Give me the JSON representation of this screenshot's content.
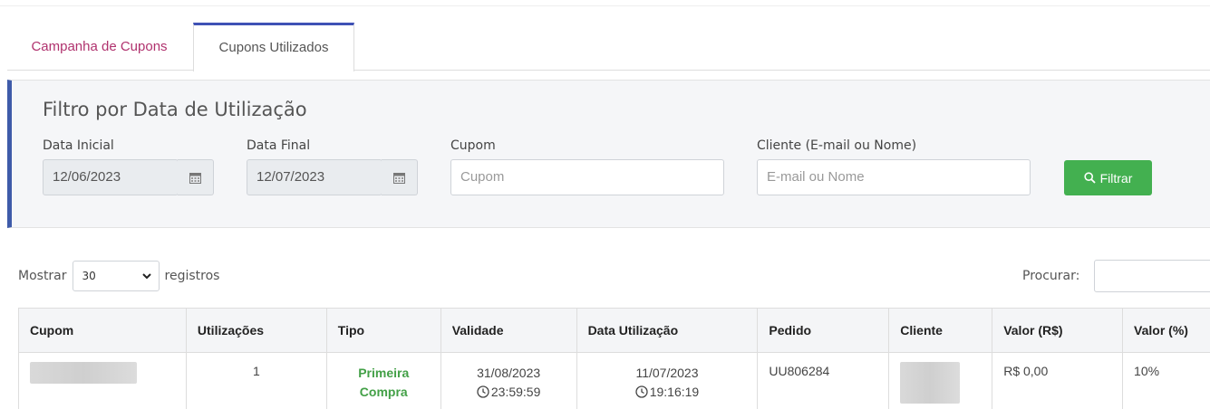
{
  "tabs": [
    {
      "label": "Campanha de Cupons",
      "active": false
    },
    {
      "label": "Cupons Utilizados",
      "active": true
    }
  ],
  "filter": {
    "title": "Filtro por Data de Utilização",
    "data_inicial": {
      "label": "Data Inicial",
      "value": "12/06/2023"
    },
    "data_final": {
      "label": "Data Final",
      "value": "12/07/2023"
    },
    "cupom": {
      "label": "Cupom",
      "placeholder": "Cupom"
    },
    "cliente": {
      "label": "Cliente (E-mail ou Nome)",
      "placeholder": "E-mail ou Nome"
    },
    "button_label": "Filtrar"
  },
  "length": {
    "prefix": "Mostrar",
    "value": "30",
    "suffix": "registros"
  },
  "search": {
    "label": "Procurar:"
  },
  "table": {
    "columns": [
      "Cupom",
      "Utilizações",
      "Tipo",
      "Validade",
      "Data Utilização",
      "Pedido",
      "Cliente",
      "Valor (R$)",
      "Valor (%)"
    ],
    "rows": [
      {
        "utilizacoes": "1",
        "tipo_line1": "Primeira",
        "tipo_line2": "Compra",
        "validade_date": "31/08/2023",
        "validade_time": "23:59:59",
        "data_date": "11/07/2023",
        "data_time": "19:16:19",
        "pedido": "UU806284",
        "valor_rs": "R$ 0,00",
        "valor_pct": "10%"
      }
    ]
  },
  "colors": {
    "accent": "#3e5ba9",
    "tab_inactive": "#b0326e",
    "button": "#43b050",
    "tipo": "#43a047"
  },
  "icons": [
    "calendar-icon",
    "search-icon",
    "chevron-down-icon",
    "clock-icon"
  ]
}
